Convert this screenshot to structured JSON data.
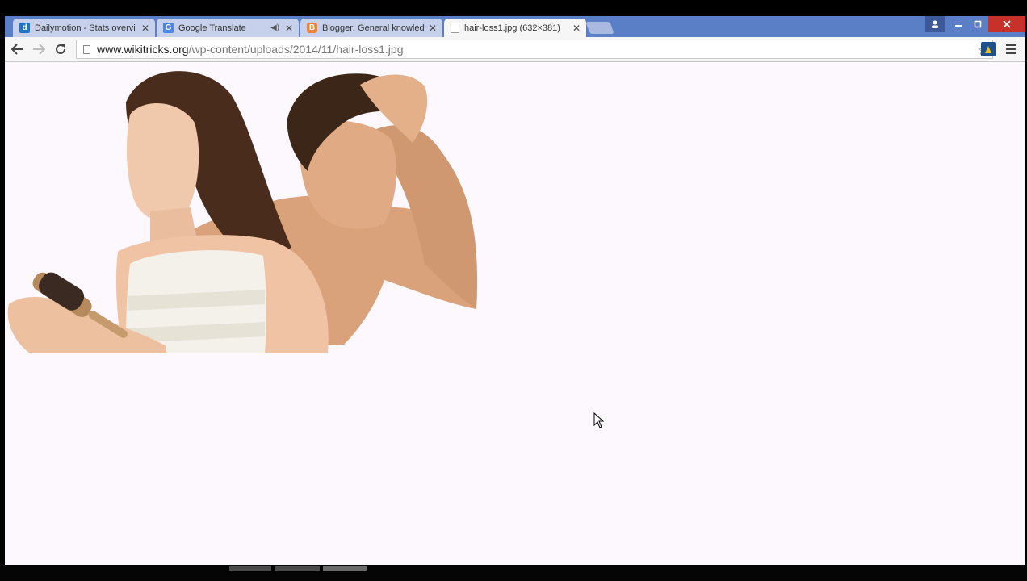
{
  "tabs": [
    {
      "title": "Dailymotion - Stats overvi",
      "favicon": "dailymotion-icon",
      "favicon_letter": "d",
      "favicon_color": "#1e73c8"
    },
    {
      "title": "Google Translate",
      "favicon": "google-translate-icon",
      "favicon_letter": "G",
      "favicon_color": "#4a86e8"
    },
    {
      "title": "Blogger: General knowled",
      "favicon": "blogger-icon",
      "favicon_letter": "B",
      "favicon_color": "#f0813a"
    },
    {
      "title": "hair-loss1.jpg (632×381)",
      "favicon": "page-icon"
    }
  ],
  "toolbar": {
    "url_host": "www.wikitricks.org",
    "url_path": "/wp-content/uploads/2014/11/hair-loss1.jpg"
  },
  "colors": {
    "titlebar": "#5a7fc7",
    "inactive_tab": "#c7d1ec",
    "active_tab": "#f6f6f6",
    "page_background": "#fdf8fd"
  },
  "image": {
    "subject": "woman holding hairbrush with fallen hair and man touching his hairline"
  }
}
